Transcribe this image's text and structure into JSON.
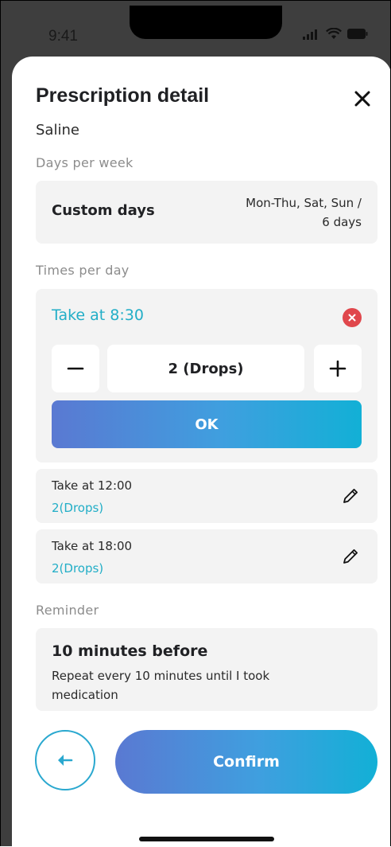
{
  "status_bar": {
    "time": "9:41"
  },
  "header": {
    "title": "Prescription detail",
    "close_icon": "close-icon"
  },
  "medication_name": "Saline",
  "days_per_week": {
    "label": "Days per week",
    "mode": "Custom days",
    "value_line1": "Mon-Thu, Sat, Sun /",
    "value_line2": "6 days"
  },
  "times_per_day": {
    "label": "Times per day",
    "editing": {
      "title": "Take at 8:30",
      "quantity": "2 (Drops)",
      "ok_label": "OK"
    },
    "doses": [
      {
        "time": "Take at 12:00",
        "amount": "2(Drops)"
      },
      {
        "time": "Take at 18:00",
        "amount": "2(Drops)"
      }
    ]
  },
  "reminder": {
    "label": "Reminder",
    "title": "10 minutes before",
    "description": "Repeat every 10 minutes until I took medication"
  },
  "footer": {
    "confirm_label": "Confirm"
  },
  "colors": {
    "accent": "#22aec7",
    "danger": "#e0474c",
    "card_bg": "#f3f3f3",
    "gradient_start": "#5a79d2",
    "gradient_end": "#12b0d6"
  }
}
